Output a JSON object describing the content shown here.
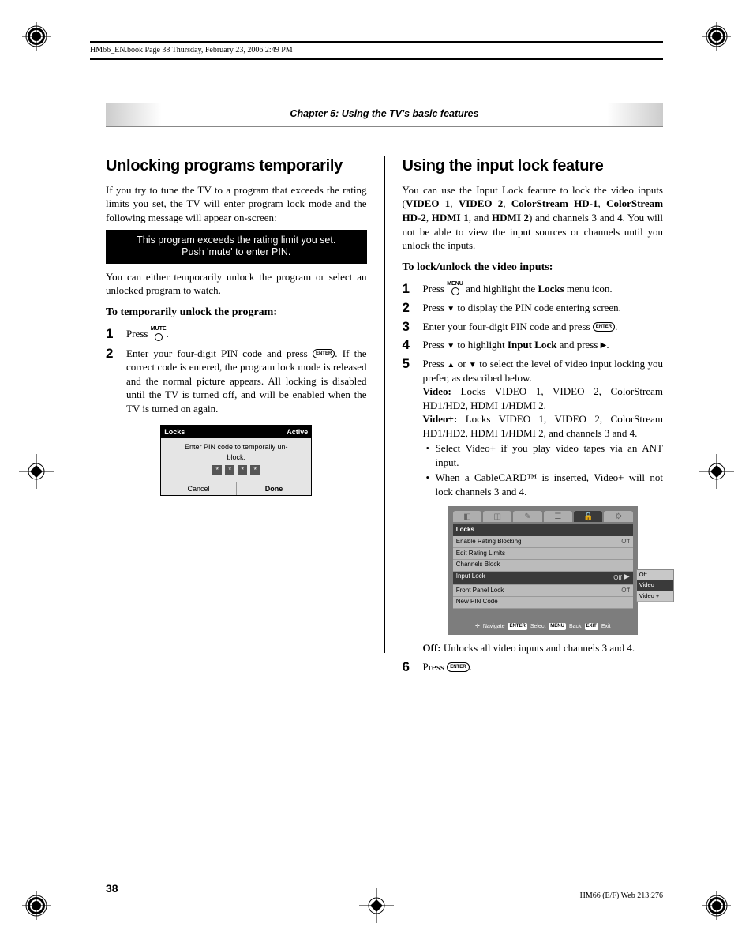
{
  "header": {
    "text": "HM66_EN.book  Page 38  Thursday, February 23, 2006  2:49 PM"
  },
  "footer": {
    "text": "HM66 (E/F) Web 213:276"
  },
  "chapter": "Chapter 5: Using the TV's basic features",
  "pageNumber": "38",
  "left": {
    "heading": "Unlocking programs temporarily",
    "p1": "If you try to tune the TV to a program that exceeds the rating limits you set, the TV will enter program lock mode and the following message will appear on-screen:",
    "boxL1": "This program exceeds the rating limit you set.",
    "boxL2": "Push 'mute' to enter PIN.",
    "p2": "You can either temporarily unlock the program or select an unlocked program to watch.",
    "sub": "To temporarily unlock the program:",
    "step1a": "Press ",
    "step1b": ".",
    "step2a": "Enter your four-digit PIN code and press ",
    "step2b": ". If the correct code is entered, the program lock mode is released and the normal picture appears. All locking is disabled until the TV is turned off, and will be enabled when the TV is turned on again.",
    "dialog": {
      "title": "Locks",
      "status": "Active",
      "msg": "Enter PIN code to temporaily un-\nblock.",
      "cancel": "Cancel",
      "done": "Done"
    }
  },
  "right": {
    "heading": "Using the input lock feature",
    "p1a": "You can use the Input Lock feature to lock the video inputs (",
    "v1": "VIDEO 1",
    "v2": "VIDEO 2",
    "v3": "ColorStream HD-1",
    "v4": "ColorStream HD-2",
    "v5": "HDMI 1",
    "v6": "HDMI 2",
    "p1b": ") and channels 3 and 4. You will not be able to view the input sources or channels until you unlock the inputs.",
    "sub": "To lock/unlock the video inputs:",
    "s1a": "Press ",
    "s1b": " and highlight the ",
    "s1c": "Locks",
    "s1d": " menu icon.",
    "s2a": "Press ",
    "s2b": " to display the PIN code entering screen.",
    "s3a": "Enter your four-digit PIN code and press ",
    "s3b": ".",
    "s4a": "Press ",
    "s4b": " to highlight ",
    "s4c": "Input Lock",
    "s4d": " and press ",
    "s4e": ".",
    "s5a": "Press ",
    "s5b": " or ",
    "s5c": " to select the level of video input locking you prefer, as described below.",
    "vidLbl": "Video:",
    "vid": " Locks VIDEO 1, VIDEO 2, ColorStream HD1/HD2, HDMI 1/HDMI 2.",
    "vidpLbl": "Video+:",
    "vidp": " Locks VIDEO 1, VIDEO 2, ColorStream HD1/HD2, HDMI 1/HDMI 2, and channels 3 and 4.",
    "b1": "Select Video+ if you play video tapes via an ANT input.",
    "b2": "When a CableCARD™ is inserted, Video+ will not lock channels 3 and 4.",
    "offLbl": "Off:",
    "off": " Unlocks all video inputs and channels 3 and 4.",
    "s6a": "Press ",
    "s6b": ".",
    "menu": {
      "title": "Locks",
      "rows": [
        {
          "l": "Enable Rating Blocking",
          "r": "Off"
        },
        {
          "l": "Edit Rating Limits",
          "r": ""
        },
        {
          "l": "Channels Block",
          "r": ""
        },
        {
          "l": "Input Lock",
          "r": "Off",
          "sel": true
        },
        {
          "l": "Front Panel Lock",
          "r": "Off"
        },
        {
          "l": "New PIN Code",
          "r": ""
        }
      ],
      "sub": [
        "Off",
        "Video",
        "Video +"
      ],
      "nav": "Navigate",
      "sel": "Select",
      "back": "Back",
      "exit": "Exit",
      "navK": "✛",
      "selK": "ENTER",
      "backK": "MENU",
      "exitK": "EXIT"
    }
  },
  "buttons": {
    "mute": "MUTE",
    "menu": "MENU",
    "enter": "ENTER"
  }
}
